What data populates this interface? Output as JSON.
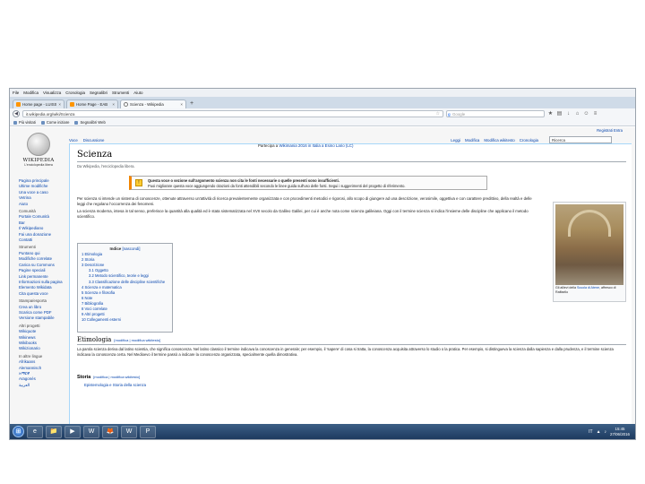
{
  "browser": {
    "menu": [
      "File",
      "Modifica",
      "Visualizza",
      "Cronologia",
      "Segnalibri",
      "Strumenti",
      "Aiuto"
    ],
    "tabs": [
      {
        "label": "Home page - LUISS",
        "active": false
      },
      {
        "label": "Home Page - EAB",
        "active": false
      },
      {
        "label": "Scienza - Wikipedia",
        "active": true
      }
    ],
    "new_tab": "+",
    "url": "it.wikipedia.org/wiki/Scienza",
    "search_placeholder": "Google",
    "bookmarks": [
      "Più visitati",
      "Come iniziare",
      "Segnalibri Web"
    ]
  },
  "wiki": {
    "logo_wordmark": "WIKIPEDIA",
    "logo_tagline": "L'enciclopedia libera",
    "user_links": "Registrati   Entra",
    "page_tabs": [
      "Voce",
      "Discussione"
    ],
    "view_tabs": [
      "Leggi",
      "Modifica",
      "Modifica wikitesto",
      "Cronologia"
    ],
    "search_value": "Ricerca",
    "sidebar": {
      "main": [
        "Pagina principale",
        "Ultime modifiche",
        "Una voce a caso",
        "Vetrina",
        "Aiuto"
      ],
      "community_head": "Comunità",
      "community": [
        "Portale Comunità",
        "Bar",
        "Il Wikipediano",
        "Fai una donazione",
        "Contatti"
      ],
      "tools_head": "Strumenti",
      "tools": [
        "Puntano qui",
        "Modifiche correlate",
        "Carica su Commons",
        "Pagine speciali",
        "Link permanente",
        "Informazioni sulla pagina",
        "Elemento Wikidata",
        "Cita questa voce"
      ],
      "print_head": "Stampa/esporta",
      "print": [
        "Crea un libro",
        "Scarica come PDF",
        "Versione stampabile"
      ],
      "projects_head": "Altri progetti",
      "projects": [
        "Wikiquote",
        "Wikinews",
        "Wikibooks",
        "Wikizionario"
      ],
      "lang_head": "In altre lingue",
      "langs": [
        "Afrikaans",
        "Alemannisch",
        "አማርኛ",
        "Aragonés",
        "العربية"
      ]
    },
    "banner_text": "Partecipa a ",
    "banner_link": "Wikimania 2016 in Italia a Esino Lario (LC)",
    "title": "Scienza",
    "from": "Da Wikipedia, l'enciclopedia libera.",
    "notice_bold": "Questa voce o sezione sull'argomento scienza non cita le fonti necessarie o quelle presenti sono insufficienti.",
    "notice_text": "Puoi migliorare questa voce aggiungendo citazioni da fonti attendibili secondo le linee guida sull'uso delle fonti. Segui i suggerimenti del progetto di riferimento.",
    "lead_1": "Per scienza si intende un sistema di conoscenze, ottenute attraverso un'attività di ricerca prevalentemente organizzata e con procedimenti metodici e rigorosi, allo scopo di giungere ad una descrizione, verosimile, oggettiva e con carattere predittivo, della realtà e delle leggi che regolano l'occorrenza dei fenomeni.",
    "lead_2": "La scienza moderna, intesa in tal senso, preferisce la quantità alla qualità ed è stata sistematizzata nel XVII secolo da Galileo Galilei, per cui è anche nota come scienza galileiana. Oggi con il termine scienza si indica l'insieme delle discipline che applicano il metodo scientifico.",
    "toc_title": "Indice",
    "toc_toggle": "[nascondi]",
    "toc": [
      {
        "label": "1 Etimologia",
        "level": 1
      },
      {
        "label": "2 Storia",
        "level": 1
      },
      {
        "label": "3 Descrizione",
        "level": 1
      },
      {
        "label": "3.1 Oggetto",
        "level": 2
      },
      {
        "label": "3.2 Metodo scientifico, teorie e leggi",
        "level": 2
      },
      {
        "label": "3.3 Classificazione delle discipline scientifiche",
        "level": 2
      },
      {
        "label": "4 Scienza e matematica",
        "level": 1
      },
      {
        "label": "5 Scienza e filosofia",
        "level": 1
      },
      {
        "label": "6 Note",
        "level": 1
      },
      {
        "label": "7 Bibliografia",
        "level": 1
      },
      {
        "label": "8 Voci correlate",
        "level": 1
      },
      {
        "label": "9 Altri progetti",
        "level": 1
      },
      {
        "label": "10 Collegamenti esterni",
        "level": 1
      }
    ],
    "thumb_caption_1": "Gli allievi della ",
    "thumb_caption_link": "Scuola di Atene",
    "thumb_caption_2": ", affresco di Raffaello",
    "etym_title": "Etimologia",
    "etym_edit": "[modifica | modifica wikitesto]",
    "etym_text": "La parola scienza deriva dal latino scientia, che significa conoscenza. Nel latino classico il termine indicava la conoscenza in generale; per esempio, il 'sapere' di cosa si tratta, la conoscenza acquisita attraverso lo studio o la pratica. Per esempio, si distingueva la scienza dalla sapienza e dalla prudenza, e il termine scienza indicava la conoscenza certa. Nel Medioevo il termine passò a indicare la conoscenza organizzata, specialmente quella dimostrativa.",
    "history_title": "Storia",
    "history_edit": "[modifica | modifica wikitesto]",
    "history_sub": "Epistemologia e Storia della scienza"
  },
  "taskbar": {
    "apps": [
      "e",
      "📁",
      "▶",
      "W",
      "🦊",
      "W",
      "P"
    ],
    "tray_lang": "IT",
    "time": "15:45",
    "date": "27/06/2016"
  }
}
